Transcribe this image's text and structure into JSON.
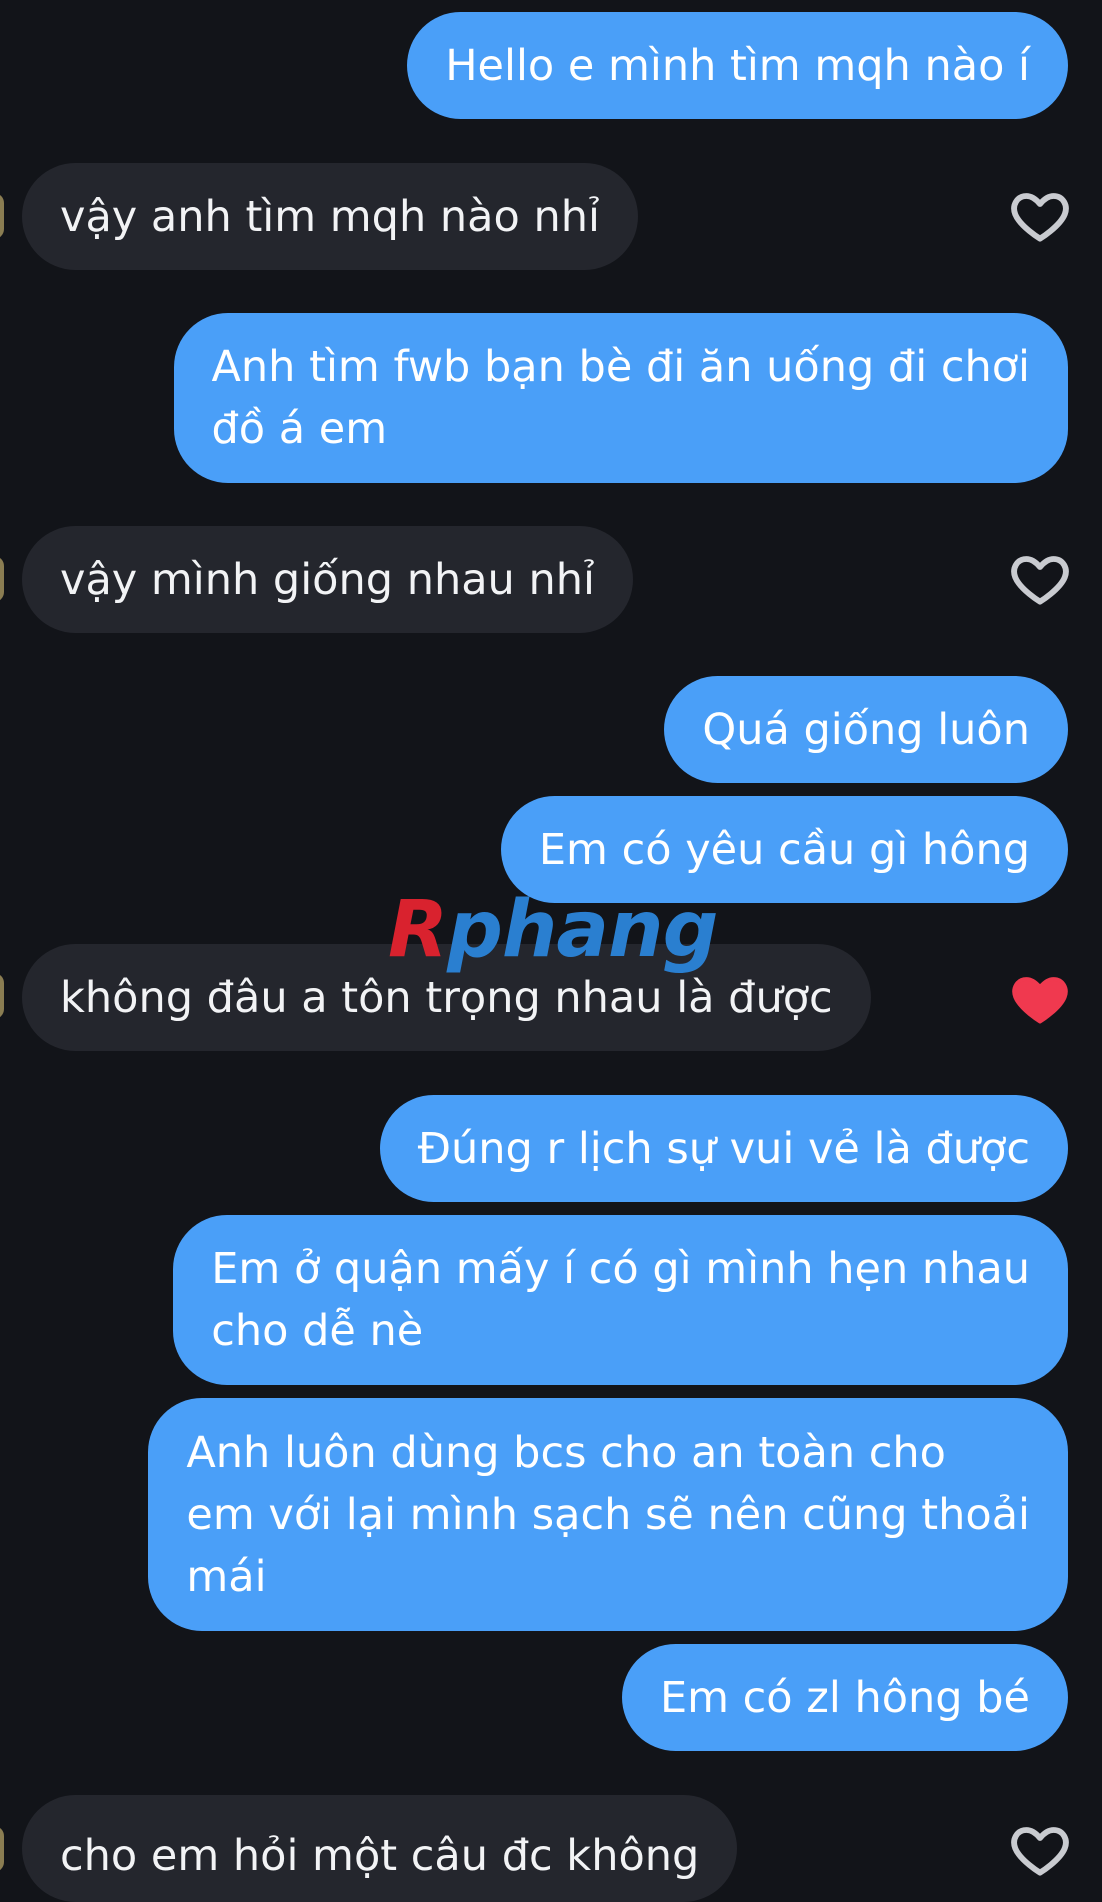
{
  "messages": [
    {
      "dir": "out",
      "text": "Hello e mình tìm mqh nào í"
    },
    {
      "dir": "in",
      "text": "vậy anh tìm mqh nào nhỉ",
      "liked": false
    },
    {
      "dir": "out",
      "text": "Anh tìm fwb bạn bè đi ăn uống đi chơi\nđồ á em"
    },
    {
      "dir": "in",
      "text": "vậy mình giống nhau nhỉ",
      "liked": false
    },
    {
      "dir": "out",
      "text": "Quá giống luôn"
    },
    {
      "dir": "out",
      "text": "Em có yêu cầu gì hông"
    },
    {
      "dir": "in",
      "text": "không đâu a tôn trọng nhau là được",
      "liked": true
    },
    {
      "dir": "out",
      "text": "Đúng r lịch sự vui vẻ là được"
    },
    {
      "dir": "out",
      "text": "Em ở quận mấy í có gì mình hẹn nhau\ncho dễ nè"
    },
    {
      "dir": "out",
      "text": "Anh luôn dùng bcs cho an toàn cho\nem với lại mình sạch sẽ nên cũng thoải\nmái"
    },
    {
      "dir": "out",
      "text": "Em có zl hông bé"
    },
    {
      "dir": "in",
      "text": "cho em hỏi một câu đc không",
      "liked": false
    }
  ],
  "icons": {
    "like": "heart-icon"
  },
  "colors": {
    "background": "#121419",
    "outgoing_bubble": "#4a9ff8",
    "incoming_bubble": "#24262d",
    "heart_outline": "#c9cbd0",
    "heart_liked": "#f0394f"
  },
  "watermark": {
    "part1": "R",
    "part2": "phang"
  }
}
